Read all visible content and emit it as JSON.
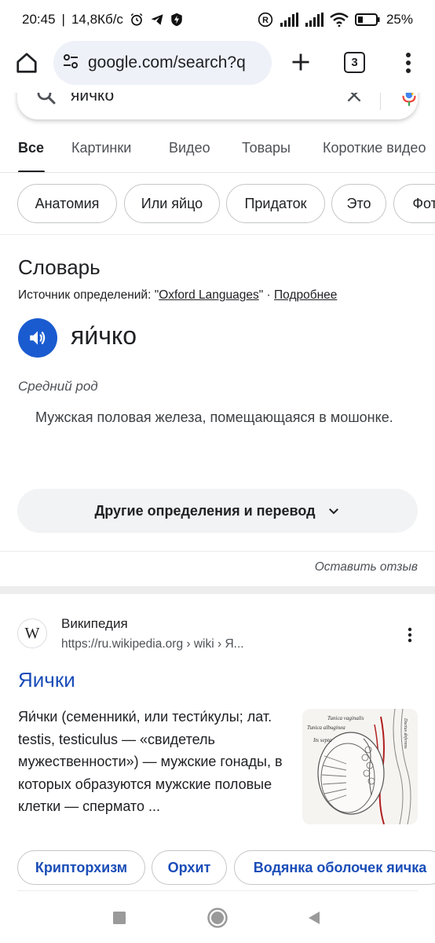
{
  "status_bar": {
    "time": "20:45",
    "speed": "14,8Кб/с",
    "battery": "25%"
  },
  "toolbar": {
    "url": "google.com/search?q",
    "tab_count": "3"
  },
  "search": {
    "query": "яичко"
  },
  "tabs": [
    "Все",
    "Картинки",
    "Видео",
    "Товары",
    "Короткие видео"
  ],
  "chips": [
    "Анатомия",
    "Или яйцо",
    "Придаток",
    "Это",
    "Фото"
  ],
  "dictionary": {
    "title": "Словарь",
    "source_prefix": "Источник определений: \"",
    "source_link": "Oxford Languages",
    "source_sep": "\" · ",
    "more_link": "Подробнее",
    "word": "яи́чко",
    "part_of_speech": "Средний род",
    "definition": "Мужская половая железа, помещающаяся в мошонке.",
    "more_button": "Другие определения и перевод",
    "feedback": "Оставить отзыв"
  },
  "result": {
    "site_name": "Википедия",
    "url": "https://ru.wikipedia.org › wiki › Я...",
    "favicon_letter": "W",
    "title": "Яички",
    "snippet": "Яи́чки (семенники́, или тести́кулы; лат. testis, testiculus — «свидетель мужественности») — мужские гонады, в которых образуются мужские половые клетки — спермато ...",
    "thumb_labels": [
      "Tunica vaginalis",
      "Tunica albuginea",
      "Ductus deferens",
      "Its septa"
    ]
  },
  "related": [
    "Крипторхизм",
    "Орхит",
    "Водянка оболочек яичка"
  ],
  "colors": {
    "link_blue": "#1a4db8",
    "speaker_blue": "#1a5bd0",
    "url_bar": "#eef1f8"
  }
}
